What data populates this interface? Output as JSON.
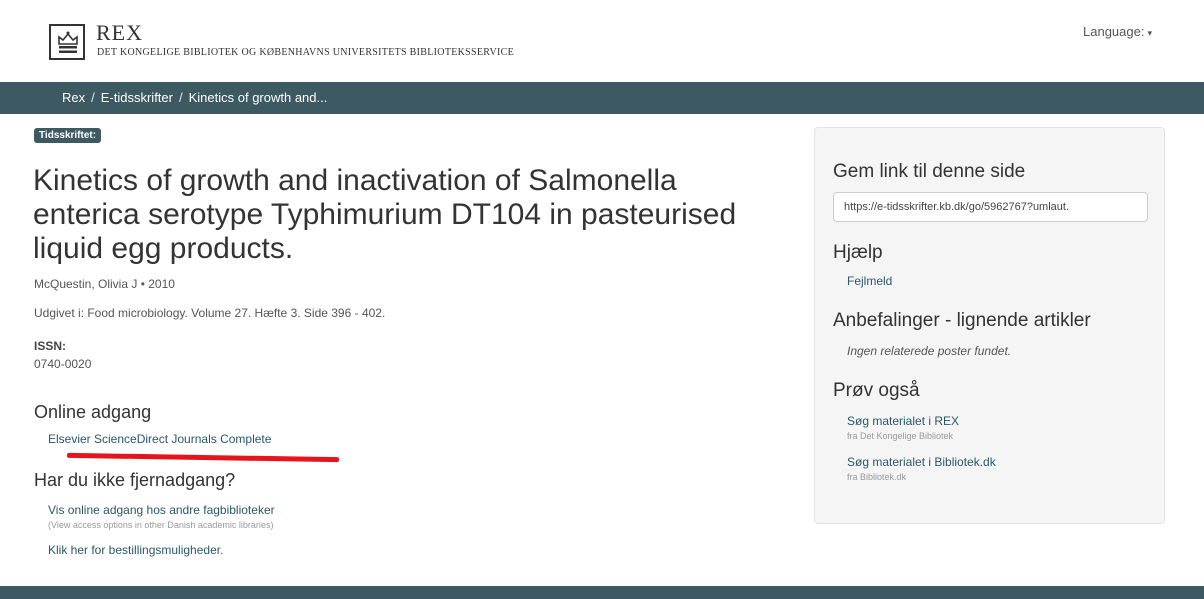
{
  "header": {
    "brand": "REX",
    "subtitle": "DET KONGELIGE BIBLIOTEK OG KØBENHAVNS UNIVERSITETS BIBLIOTEKSSERVICE",
    "language_label": "Language:"
  },
  "breadcrumb": {
    "items": [
      "Rex",
      "E-tidsskrifter",
      "Kinetics of growth and..."
    ],
    "separator": "/"
  },
  "record": {
    "badge": "Tidsskriftet:",
    "title": "Kinetics of growth and inactivation of Salmonella enterica serotype Typhimurium DT104 in pasteurised liquid egg products.",
    "author_year": "McQuestin, Olivia J • 2010",
    "published": "Udgivet i: Food microbiology. Volume 27. Hæfte 3. Side 396 - 402.",
    "issn_label": "ISSN:",
    "issn": "0740-0020"
  },
  "online_access": {
    "heading": "Online adgang",
    "link": "Elsevier ScienceDirect Journals Complete"
  },
  "remote_access": {
    "heading": "Har du ikke fjernadgang?",
    "link": "Vis online adgang hos andre fagbiblioteker",
    "note": "(View access options in other Danish academic libraries)",
    "order_link": "Klik her for bestillingsmuligheder."
  },
  "sidebar": {
    "save_heading": "Gem link til denne side",
    "url_value": "https://e-tidsskrifter.kb.dk/go/5962767?umlaut.",
    "help_heading": "Hjælp",
    "report_link": "Fejlmeld",
    "recommend_heading": "Anbefalinger - lignende artikler",
    "recommend_empty": "Ingen relaterede poster fundet.",
    "try_heading": "Prøv også",
    "try_items": [
      {
        "label": "Søg materialet i REX",
        "source": "fra Det Kongelige Bibliotek"
      },
      {
        "label": "Søg materialet i Bibliotek.dk",
        "source": "fra Bibliotek.dk"
      }
    ]
  },
  "colors": {
    "bar": "#3d5a62",
    "link": "#2a5868",
    "highlight": "#e8141c"
  },
  "icons": {
    "logo": "crown-icon",
    "language": "caret-down-icon"
  }
}
